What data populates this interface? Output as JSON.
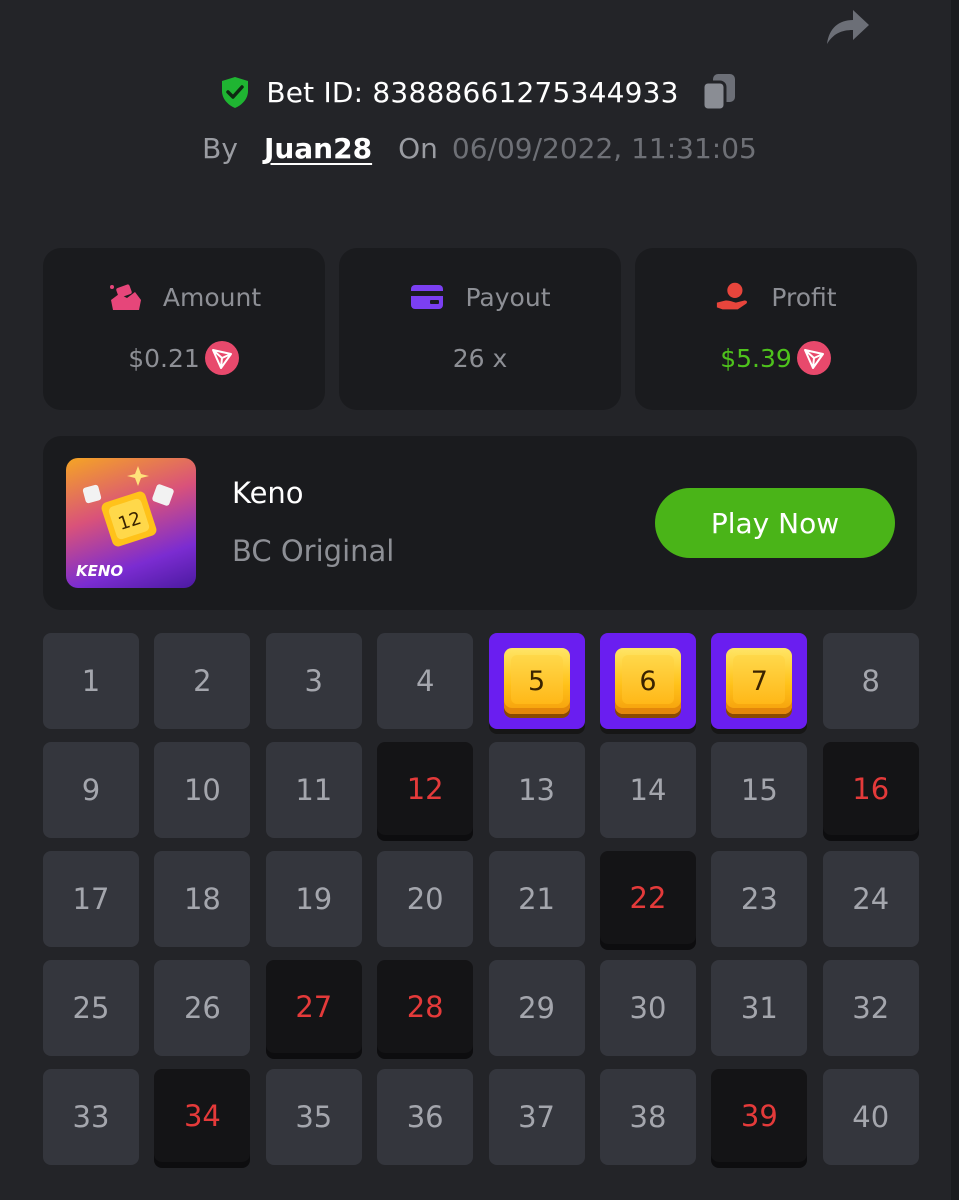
{
  "header": {
    "bet_id_label": "Bet ID: 83888661275344933",
    "by_label": "By",
    "username": "Juan28",
    "on_label": "On",
    "datetime": "06/09/2022, 11:31:05"
  },
  "stats": {
    "amount": {
      "label": "Amount",
      "value": "$0.21",
      "icon": "amount-icon"
    },
    "payout": {
      "label": "Payout",
      "value": "26 x",
      "icon": "card-icon"
    },
    "profit": {
      "label": "Profit",
      "value": "$5.39",
      "icon": "profit-hand-icon"
    }
  },
  "game": {
    "name": "Keno",
    "provider": "BC Original",
    "thumb_label": "KENO",
    "play_label": "Play Now"
  },
  "colors": {
    "background": "#232428",
    "card": "#1a1b1e",
    "accent_green": "#4ab418",
    "hit_purple": "#6a1ef0",
    "drawn_red": "#e43a3a"
  },
  "keno_grid": [
    {
      "n": "1",
      "state": "normal"
    },
    {
      "n": "2",
      "state": "normal"
    },
    {
      "n": "3",
      "state": "normal"
    },
    {
      "n": "4",
      "state": "normal"
    },
    {
      "n": "5",
      "state": "hit"
    },
    {
      "n": "6",
      "state": "hit"
    },
    {
      "n": "7",
      "state": "hit"
    },
    {
      "n": "8",
      "state": "normal"
    },
    {
      "n": "9",
      "state": "normal"
    },
    {
      "n": "10",
      "state": "normal"
    },
    {
      "n": "11",
      "state": "normal"
    },
    {
      "n": "12",
      "state": "drawn"
    },
    {
      "n": "13",
      "state": "normal"
    },
    {
      "n": "14",
      "state": "normal"
    },
    {
      "n": "15",
      "state": "normal"
    },
    {
      "n": "16",
      "state": "drawn"
    },
    {
      "n": "17",
      "state": "normal"
    },
    {
      "n": "18",
      "state": "normal"
    },
    {
      "n": "19",
      "state": "normal"
    },
    {
      "n": "20",
      "state": "normal"
    },
    {
      "n": "21",
      "state": "normal"
    },
    {
      "n": "22",
      "state": "drawn"
    },
    {
      "n": "23",
      "state": "normal"
    },
    {
      "n": "24",
      "state": "normal"
    },
    {
      "n": "25",
      "state": "normal"
    },
    {
      "n": "26",
      "state": "normal"
    },
    {
      "n": "27",
      "state": "drawn"
    },
    {
      "n": "28",
      "state": "drawn"
    },
    {
      "n": "29",
      "state": "normal"
    },
    {
      "n": "30",
      "state": "normal"
    },
    {
      "n": "31",
      "state": "normal"
    },
    {
      "n": "32",
      "state": "normal"
    },
    {
      "n": "33",
      "state": "normal"
    },
    {
      "n": "34",
      "state": "drawn"
    },
    {
      "n": "35",
      "state": "normal"
    },
    {
      "n": "36",
      "state": "normal"
    },
    {
      "n": "37",
      "state": "normal"
    },
    {
      "n": "38",
      "state": "normal"
    },
    {
      "n": "39",
      "state": "drawn"
    },
    {
      "n": "40",
      "state": "normal"
    }
  ]
}
